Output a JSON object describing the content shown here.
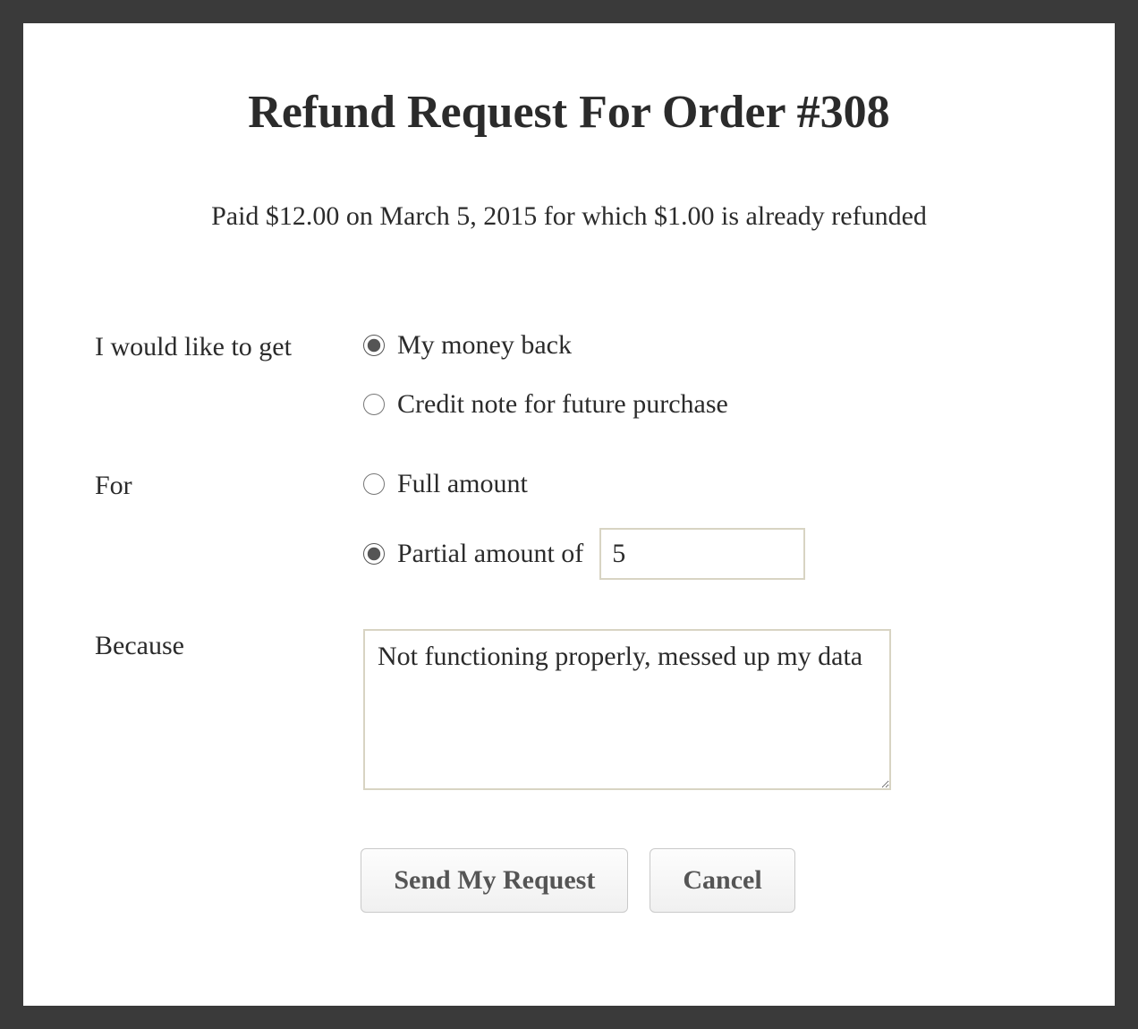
{
  "title": "Refund Request For Order #308",
  "subtitle": "Paid $12.00 on March 5, 2015 for which $1.00 is already refunded",
  "form": {
    "get_label": "I would like to get",
    "get_options": {
      "money_back": {
        "label": "My money back",
        "checked": true
      },
      "credit_note": {
        "label": "Credit note for future purchase",
        "checked": false
      }
    },
    "for_label": "For",
    "for_options": {
      "full": {
        "label": "Full amount",
        "checked": false
      },
      "partial": {
        "label": "Partial amount of",
        "checked": true,
        "value": "5"
      }
    },
    "because_label": "Because",
    "because_value": "Not functioning properly, messed up my data"
  },
  "buttons": {
    "send": "Send My Request",
    "cancel": "Cancel"
  }
}
